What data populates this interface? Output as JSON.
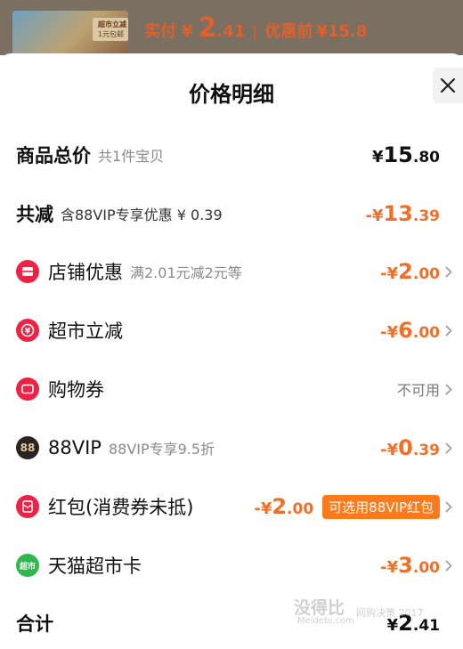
{
  "header": {
    "paid_label": "实付",
    "currency": "¥",
    "paid_int": "2",
    "paid_dec": ".41",
    "separator": "|",
    "before_label": "优惠前",
    "before_amount": "¥15.8",
    "thumb_text_1": "超市立减",
    "thumb_text_2": "1元包邮"
  },
  "sheet": {
    "title": "价格明细",
    "close_icon": "close-icon"
  },
  "rows": {
    "goods_total": {
      "label": "商品总价",
      "sub": "共1件宝贝",
      "cur": "¥",
      "int": "15",
      "dec": ".80"
    },
    "total_reduce": {
      "label": "共减",
      "sub": "含88VIP专享优惠 ¥ 0.39",
      "cur": "-¥",
      "int": "13",
      "dec": ".39"
    },
    "store_discount": {
      "label": "店铺优惠",
      "sub": "满2.01元减2元等",
      "cur": "-¥",
      "int": "2",
      "dec": ".00",
      "icon": "store-icon"
    },
    "market_reduce": {
      "label": "超市立减",
      "cur": "-¥",
      "int": "6",
      "dec": ".00",
      "icon": "yuan-icon"
    },
    "shopping_voucher": {
      "label": "购物券",
      "value": "不可用",
      "icon": "ticket-icon"
    },
    "vip88": {
      "label": "88VIP",
      "sub": "88VIP专享9.5折",
      "cur": "-¥",
      "int": "0",
      "dec": ".39",
      "icon_text": "88"
    },
    "red_packet": {
      "label": "红包(消费券未抵)",
      "cur": "-¥",
      "int": "2",
      "dec": ".00",
      "badge": "可选用88VIP红包",
      "icon": "red-packet-icon"
    },
    "tmall_card": {
      "label": "天猫超市卡",
      "cur": "-¥",
      "int": "3",
      "dec": ".00",
      "icon_text": "超市"
    },
    "total": {
      "label": "合计",
      "cur": "¥",
      "int": "2",
      "dec": ".41"
    }
  },
  "watermark": {
    "main": "没得比",
    "sub": "Meidebi.com",
    "side": "网购决策 2017"
  },
  "colors": {
    "accent": "#f0702a",
    "red": "#ee2244",
    "badge": "#ff7a1a",
    "overlay": "#7a6f61"
  }
}
